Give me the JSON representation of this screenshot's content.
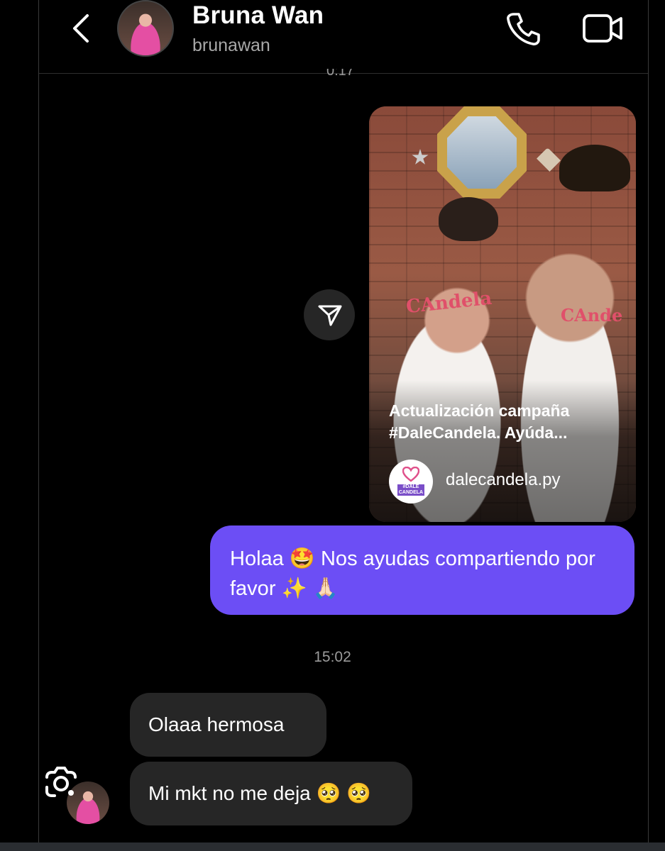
{
  "header": {
    "name": "Bruna Wan",
    "username": "brunawan",
    "cut_time": "0:17"
  },
  "post": {
    "caption": "Actualización campaña #DaleCandela. Ayúda...",
    "source": "dalecandela.py",
    "source_tag": "#DALE CANDELA",
    "shirt_logo_left": "CAndela",
    "shirt_logo_right": "CAnde"
  },
  "messages": {
    "sent_text": "Holaa 🤩 Nos ayudas compartiendo por favor ✨ 🙏🏻",
    "timestamp": "15:02",
    "recv_1": "Olaaa hermosa",
    "recv_2": "Mi mkt no me deja 🥺 🥺"
  },
  "icons": [
    "back-icon",
    "phone-icon",
    "video-icon",
    "send-icon",
    "lens-icon"
  ],
  "colors": {
    "sent_bubble": "#6c4ef5",
    "recv_bubble": "#262626",
    "background": "#000000"
  }
}
